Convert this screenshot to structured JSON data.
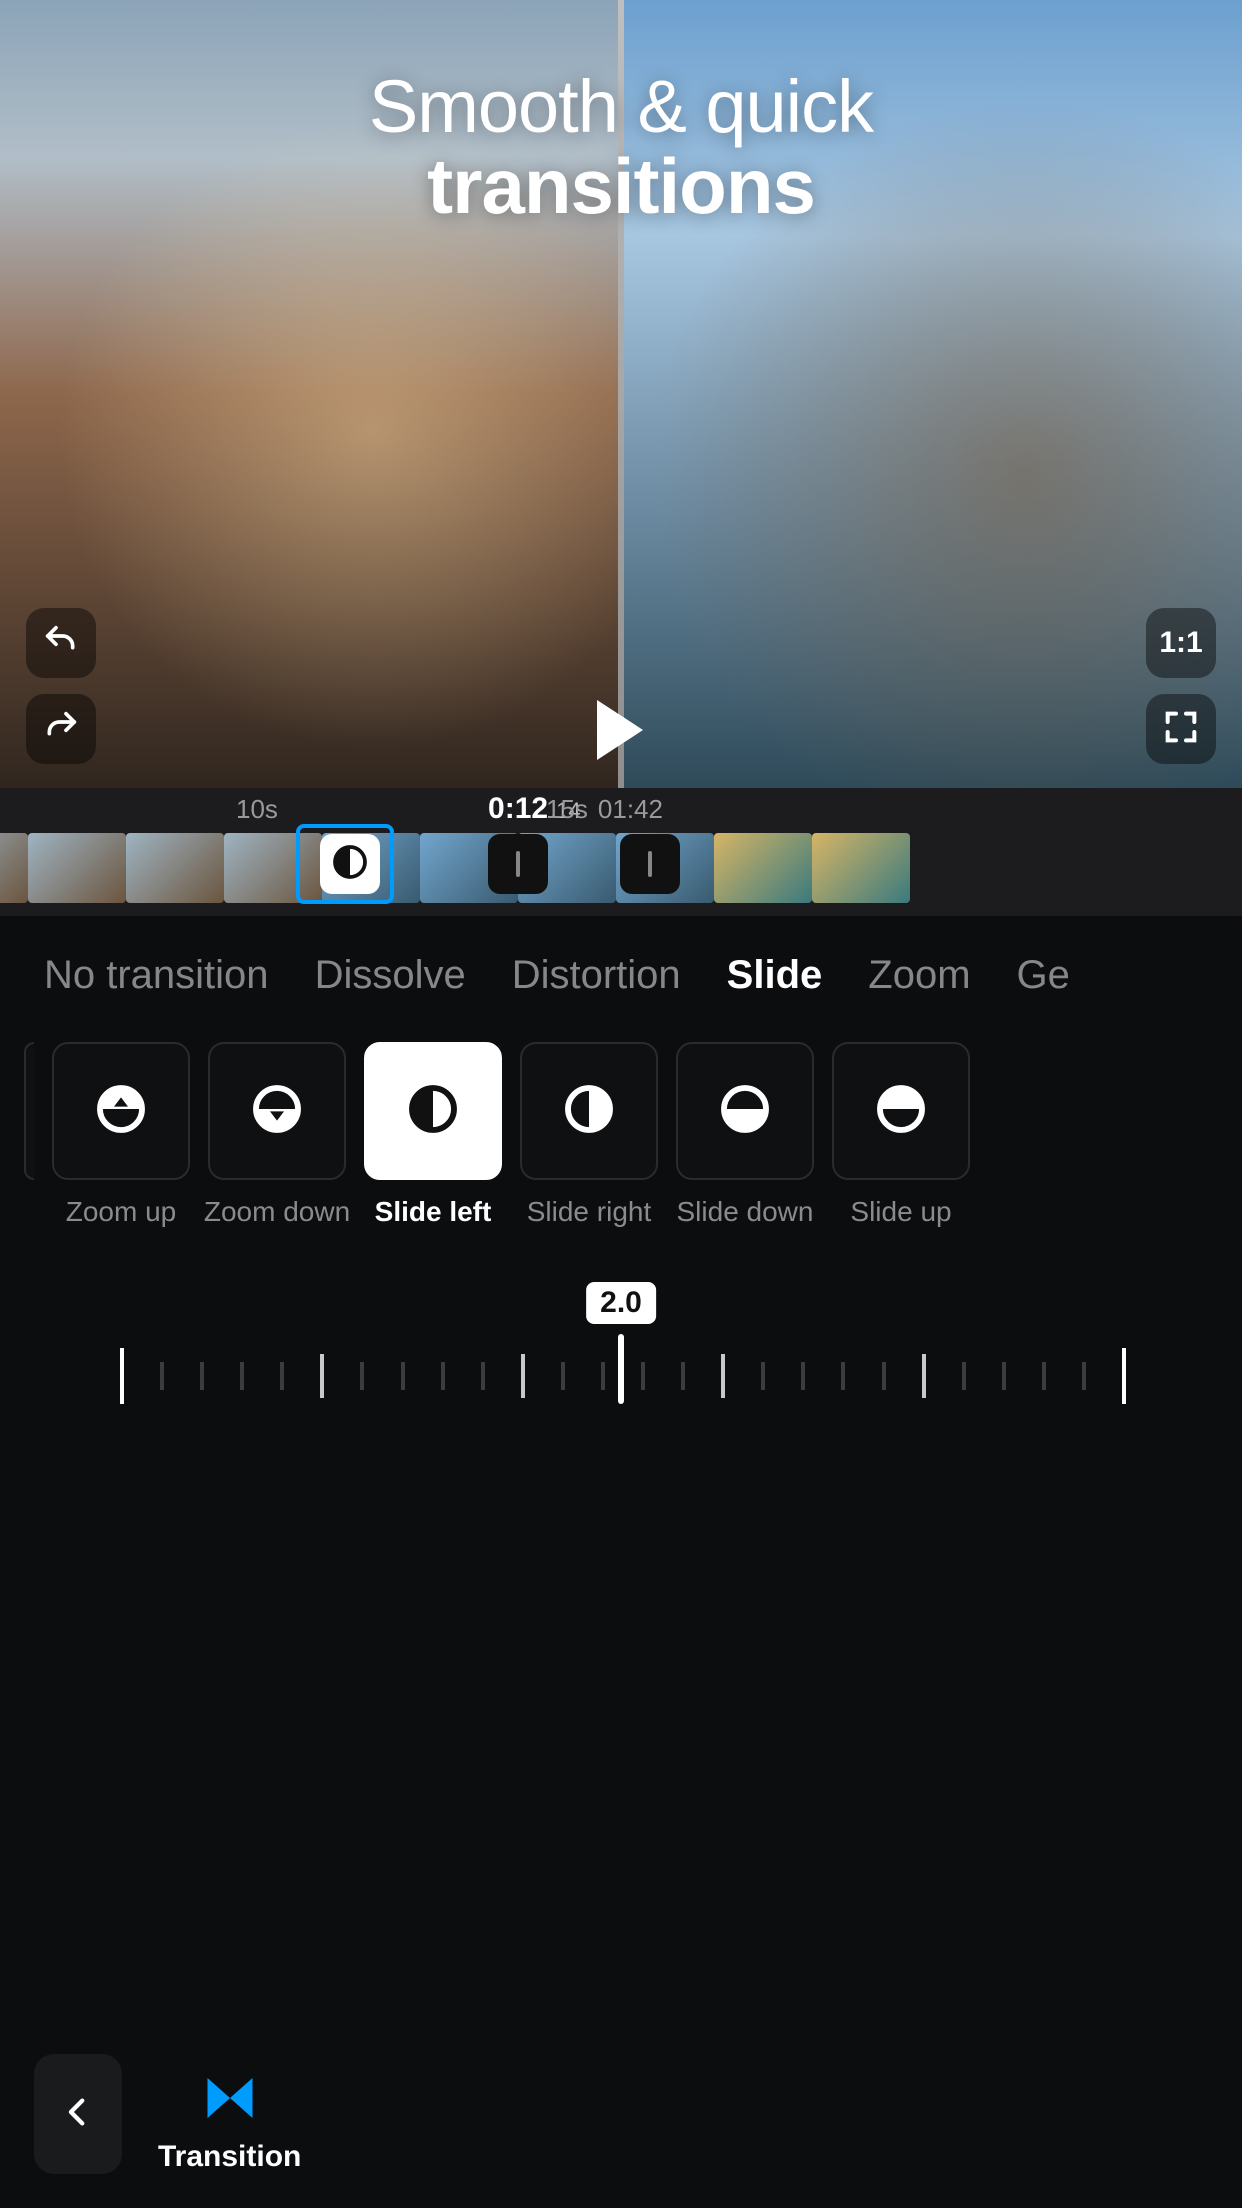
{
  "headline": {
    "line1": "Smooth & quick",
    "line2": "transitions"
  },
  "hud": {
    "aspect_ratio": "1:1"
  },
  "timeline": {
    "mark_left": "10s",
    "mark_right": "15s",
    "current_main": "0:12",
    "current_sub": ".14",
    "total": "01:42"
  },
  "categories": [
    "No transition",
    "Dissolve",
    "Distortion",
    "Slide",
    "Zoom",
    "Ge"
  ],
  "category_active_index": 3,
  "tiles": [
    {
      "id": "zoom-up",
      "label": "Zoom up",
      "selected": false
    },
    {
      "id": "zoom-down",
      "label": "Zoom down",
      "selected": false
    },
    {
      "id": "slide-left",
      "label": "Slide left",
      "selected": true
    },
    {
      "id": "slide-right",
      "label": "Slide right",
      "selected": false
    },
    {
      "id": "slide-down",
      "label": "Slide down",
      "selected": false
    },
    {
      "id": "slide-up",
      "label": "Slide up",
      "selected": false
    }
  ],
  "slider": {
    "value_label": "2.0"
  },
  "toolbar": {
    "transition_label": "Transition"
  },
  "colors": {
    "accent": "#009bff"
  }
}
